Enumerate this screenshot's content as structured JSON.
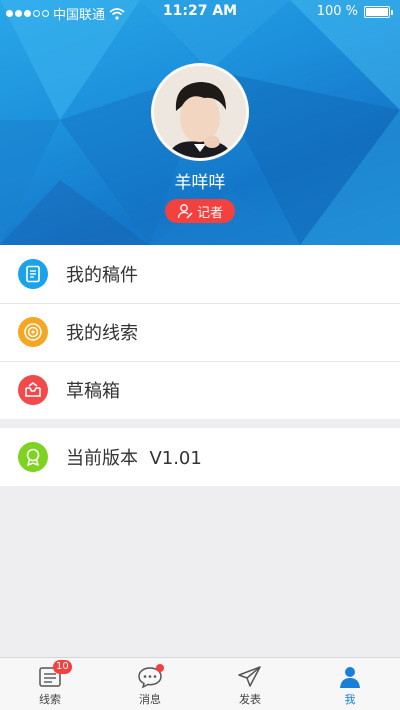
{
  "status_bar": {
    "carrier": "中国联通",
    "time": "11:27 AM",
    "battery": "100 %"
  },
  "profile": {
    "username": "羊咩咩",
    "role": "记者"
  },
  "menu": {
    "items": [
      {
        "label": "我的稿件",
        "icon": "document-icon",
        "color": "#1aa3ea"
      },
      {
        "label": "我的线索",
        "icon": "target-icon",
        "color": "#f5a623"
      },
      {
        "label": "草稿箱",
        "icon": "inbox-icon",
        "color": "#f24a4a"
      }
    ],
    "version": {
      "label": "当前版本  V1.01",
      "icon": "award-icon",
      "color": "#7ed321"
    }
  },
  "tabbar": {
    "tabs": [
      {
        "label": "线索",
        "icon": "list-icon",
        "badge": "10"
      },
      {
        "label": "消息",
        "icon": "chat-icon",
        "dot": true
      },
      {
        "label": "发表",
        "icon": "send-icon"
      },
      {
        "label": "我",
        "icon": "person-icon",
        "active": true
      }
    ],
    "active_color": "#1a7fd6"
  }
}
